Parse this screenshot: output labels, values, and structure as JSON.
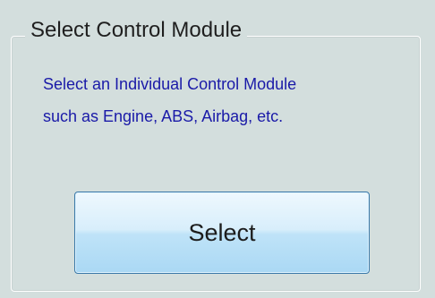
{
  "group": {
    "title": "Select Control Module",
    "description": "Select an Individual Control Module\nsuch as Engine, ABS, Airbag, etc."
  },
  "actions": {
    "select_label": "Select"
  },
  "colors": {
    "background": "#d3dedd",
    "description_text": "#1a1aa8",
    "button_border": "#3b79a8",
    "button_fill": "#bfe3f8"
  }
}
